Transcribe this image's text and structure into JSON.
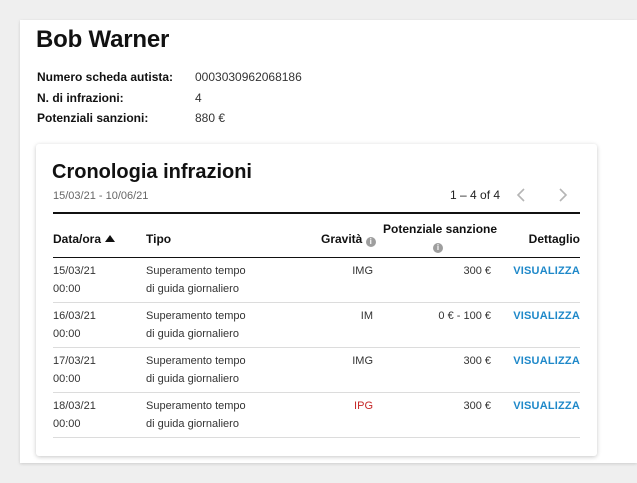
{
  "driver": {
    "name": "Bob Warner",
    "card_number_label": "Numero scheda autista:",
    "card_number_value": "0003030962068186",
    "infractions_label": "N. di infrazioni:",
    "infractions_value": "4",
    "sanctions_label": "Potenziali sanzioni:",
    "sanctions_value": "880 €"
  },
  "history": {
    "title": "Cronologia infrazioni",
    "date_range": "15/03/21 - 10/06/21",
    "pagination": "1 – 4 of 4",
    "prev_icon": "chevron-left-icon",
    "next_icon": "chevron-right-icon",
    "columns": {
      "date": "Data/ora",
      "type": "Tipo",
      "severity": "Gravità",
      "sanction_line1": "Potenziale sanzione",
      "detail": "Dettaglio"
    },
    "accent_color": "#1e88c9",
    "severity_high_color": "#c62828",
    "rows": [
      {
        "date": "15/03/21",
        "time": "00:00",
        "type_line1": "Superamento tempo",
        "type_line2": "di guida giornaliero",
        "severity": "IMG",
        "sanction": "300 €",
        "action": "VISUALIZZA"
      },
      {
        "date": "16/03/21",
        "time": "00:00",
        "type_line1": "Superamento tempo",
        "type_line2": "di guida giornaliero",
        "severity": "IM",
        "sanction": "0 € - 100 €",
        "action": "VISUALIZZA"
      },
      {
        "date": "17/03/21",
        "time": "00:00",
        "type_line1": "Superamento tempo",
        "type_line2": "di guida giornaliero",
        "severity": "IMG",
        "sanction": "300 €",
        "action": "VISUALIZZA"
      },
      {
        "date": "18/03/21",
        "time": "00:00",
        "type_line1": "Superamento tempo",
        "type_line2": "di guida giornaliero",
        "severity": "IPG",
        "sanction": "300 €",
        "action": "VISUALIZZA"
      }
    ]
  }
}
